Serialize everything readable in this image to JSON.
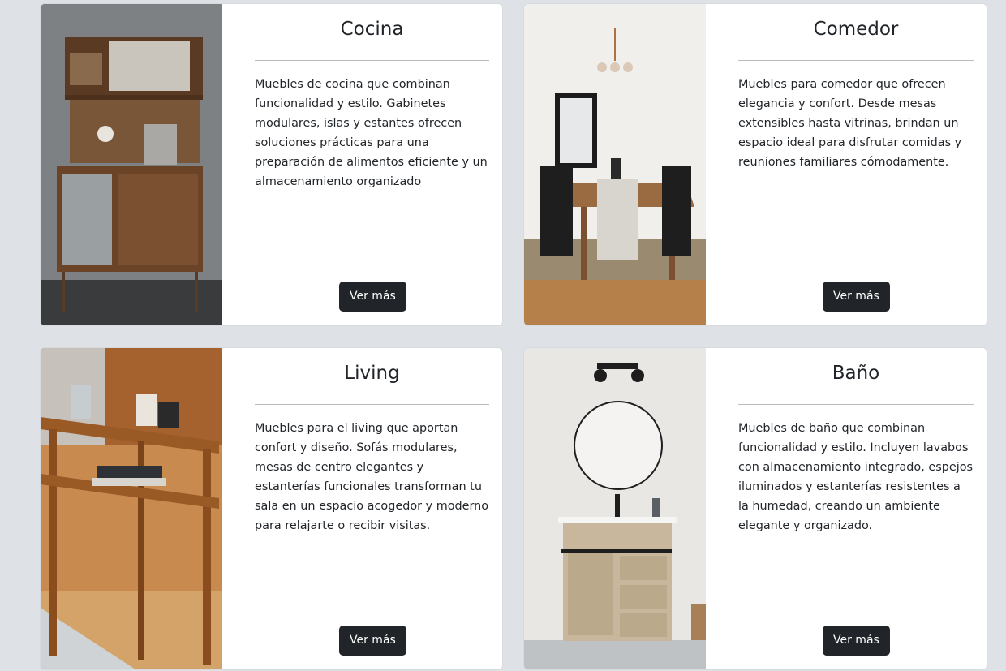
{
  "cards": [
    {
      "title": "Cocina",
      "description": "Muebles de cocina que combinan funcionalidad y estilo. Gabinetes modulares, islas y estantes ofrecen soluciones prácticas para una preparación de alimentos eficiente y un almacenamiento organizado",
      "button": "Ver más"
    },
    {
      "title": "Comedor",
      "description": "Muebles para comedor que ofrecen elegancia y confort. Desde mesas extensibles hasta vitrinas, brindan un espacio ideal para disfrutar comidas y reuniones familiares cómodamente.",
      "button": "Ver más"
    },
    {
      "title": "Living",
      "description": "Muebles para el living que aportan confort y diseño. Sofás modulares, mesas de centro elegantes y estanterías funcionales transforman tu sala en un espacio acogedor y moderno para relajarte o recibir visitas.",
      "button": "Ver más"
    },
    {
      "title": "Baño",
      "description": "Muebles de baño que combinan funcionalidad y estilo. Incluyen lavabos con almacenamiento integrado, espejos iluminados y estanterías resistentes a la humedad, creando un ambiente elegante y organizado.",
      "button": "Ver más"
    }
  ],
  "colors": {
    "page_bg": "#dee2e6",
    "card_bg": "#ffffff",
    "button_bg": "#212529",
    "button_text": "#ffffff"
  }
}
